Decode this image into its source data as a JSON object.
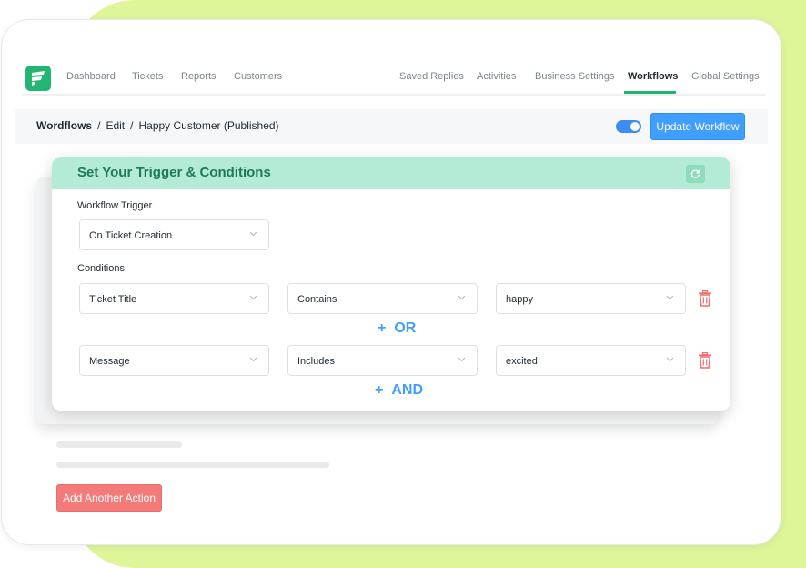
{
  "colors": {
    "accent": "#409eff",
    "brand": "#22b573",
    "header_bg": "#b3ebd6",
    "header_text": "#1f7a55",
    "danger": "#f47a7a",
    "lime_bg": "#dff59a"
  },
  "nav": {
    "logo_icon": "fluent-support-logo-icon",
    "left_items": [
      "Dashboard",
      "Tickets",
      "Reports",
      "Customers"
    ],
    "right_items": [
      "Saved Replies",
      "Activities",
      "Business Settings",
      "Workflows",
      "Global Settings"
    ],
    "active": "Workflows"
  },
  "breadcrumb": {
    "root": "Wordflows",
    "sep": "/",
    "edit": "Edit",
    "current": "Happy Customer (Published)"
  },
  "toolbar": {
    "toggle_on": true,
    "update_label": "Update Workflow"
  },
  "panel": {
    "title": "Set Your Trigger & Conditions",
    "refresh_icon": "refresh-icon",
    "trigger_label": "Workflow Trigger",
    "trigger_value": "On Ticket Creation",
    "conditions_label": "Conditions",
    "conditions": [
      {
        "field": "Ticket Title",
        "operator": "Contains",
        "value": "happy"
      },
      {
        "field": "Message",
        "operator": "Includes",
        "value": "excited"
      }
    ],
    "or_label": "OR",
    "and_label": "AND",
    "plus": "+",
    "delete_icon": "trash-icon"
  },
  "actions": {
    "add_action_label": "Add Another Action"
  }
}
